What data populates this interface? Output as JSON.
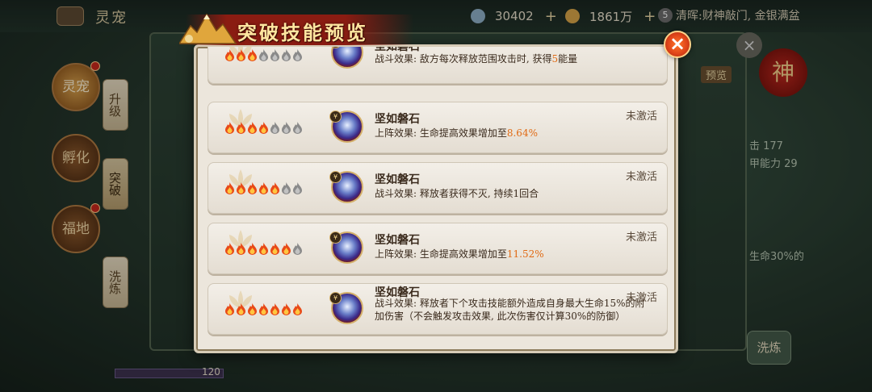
{
  "background": {
    "title": "灵宠",
    "resources": [
      {
        "icon": "gem-icon",
        "value": "30402",
        "color": "#8fb0c8"
      },
      {
        "icon": "gold-coin-icon",
        "value": "1861万",
        "color": "#d9a648"
      }
    ],
    "news_badge": "5",
    "news_text": "清晖:财神敲门, 金银满盆",
    "left_buttons": [
      "灵宠",
      "孵化",
      "福地"
    ],
    "tabs": [
      "升级",
      "突破",
      "洗炼"
    ],
    "right_badge": "神",
    "right_preview": "预览",
    "side_texts": [
      "击 177",
      "甲能力 29",
      "生命30%的"
    ],
    "bottom_button": "洗炼",
    "level_value": "120"
  },
  "modal": {
    "title": "突破技能预览",
    "close_label": "×"
  },
  "skills": [
    {
      "stars_lit": 3,
      "stars_total": 7,
      "name": "坚如磐石",
      "desc_before": "战斗效果: 敌方每次释放范围攻击时, 获得",
      "desc_highlight": "5",
      "desc_after": "能量",
      "status": ""
    },
    {
      "stars_lit": 4,
      "stars_total": 7,
      "name": "坚如磐石",
      "desc_before": "上阵效果: 生命提高效果增加至",
      "desc_highlight": "8.64%",
      "desc_after": "",
      "status": "未激活"
    },
    {
      "stars_lit": 5,
      "stars_total": 7,
      "name": "坚如磐石",
      "desc_before": "战斗效果: 释放者获得不灭, 持续1回合",
      "desc_highlight": "",
      "desc_after": "",
      "status": "未激活"
    },
    {
      "stars_lit": 6,
      "stars_total": 7,
      "name": "坚如磐石",
      "desc_before": "上阵效果: 生命提高效果增加至",
      "desc_highlight": "11.52%",
      "desc_after": "",
      "status": "未激活"
    },
    {
      "stars_lit": 7,
      "stars_total": 7,
      "name": "坚如磐石",
      "desc_before": "战斗效果: 释放者下个攻击技能额外造成自身最大生命15%的附加伤害（不会触发攻击效果, 此次伤害仅计算30%的防御）",
      "desc_highlight": "",
      "desc_after": "",
      "status": "未激活"
    }
  ]
}
